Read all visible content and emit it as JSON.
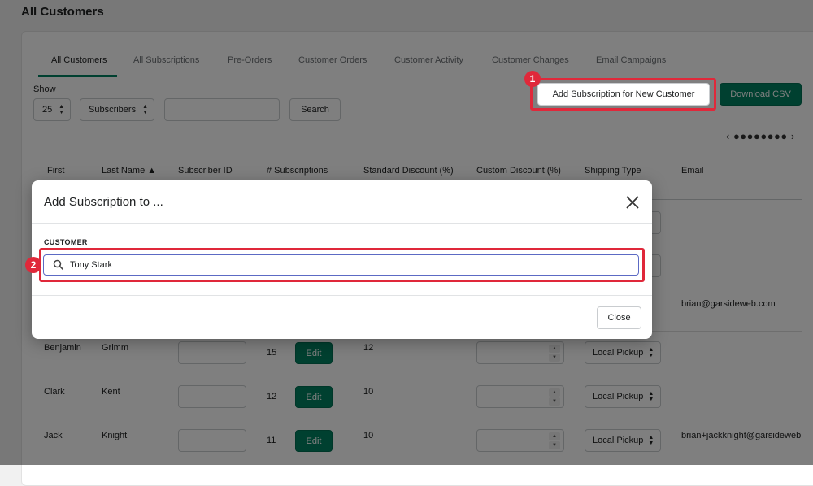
{
  "page": {
    "title": "All Customers"
  },
  "tabs": [
    {
      "label": "All Customers",
      "active": true
    },
    {
      "label": "All Subscriptions"
    },
    {
      "label": "Pre-Orders"
    },
    {
      "label": "Customer Orders"
    },
    {
      "label": "Customer Activity"
    },
    {
      "label": "Customer Changes"
    },
    {
      "label": "Email Campaigns"
    }
  ],
  "controls": {
    "show_label": "Show",
    "page_size": "25",
    "filter": "Subscribers",
    "search_value": "",
    "search_button": "Search",
    "add_subscription_button": "Add Subscription for New Customer",
    "download_csv_button": "Download CSV",
    "pager": "‹ ●●●●●●●● ›"
  },
  "annotations": {
    "step1": "1",
    "step2": "2",
    "highlight_color": "#e0283a"
  },
  "table": {
    "headers": [
      "First",
      "Last Name ▲",
      "Subscriber ID",
      "# Subscriptions",
      "Standard Discount (%)",
      "Custom Discount (%)",
      "Shipping Type",
      "Email"
    ],
    "edit_label": "Edit",
    "rows": [
      {
        "first": "",
        "last": "",
        "subs": "",
        "std": "",
        "email": ""
      },
      {
        "first": "",
        "last": "",
        "subs": "",
        "std": "",
        "email": ""
      },
      {
        "first": "",
        "last": "",
        "subs": "",
        "std": "",
        "email": "brian@garsideweb.com"
      },
      {
        "first": "Benjamin",
        "last": "Grimm",
        "subs": "15",
        "std": "12",
        "shipping": "Local Pickup",
        "email": ""
      },
      {
        "first": "Clark",
        "last": "Kent",
        "subs": "12",
        "std": "10",
        "shipping": "Local Pickup",
        "email": ""
      },
      {
        "first": "Jack",
        "last": "Knight",
        "subs": "11",
        "std": "10",
        "shipping": "Local Pickup",
        "email": "brian+jackknight@garsideweb"
      }
    ]
  },
  "modal": {
    "title": "Add Subscription to ...",
    "customer_label": "CUSTOMER",
    "customer_value": "Tony Stark",
    "close_button": "Close"
  },
  "colors": {
    "accent": "#008060",
    "overlay": "rgba(0,0,0,0.5)"
  }
}
